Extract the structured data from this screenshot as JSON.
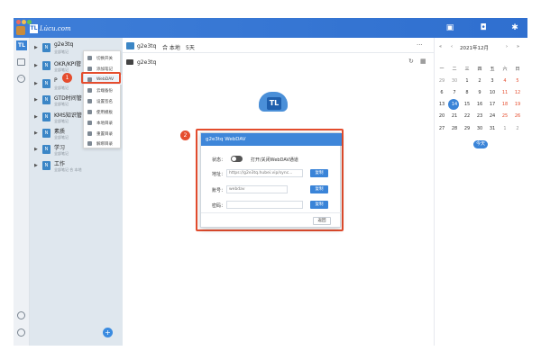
{
  "app": {
    "logo_text": "TL",
    "wordmark": "Lu̇cu.com"
  },
  "topbar_icons": [
    "note-icon",
    "shield-icon",
    "bug-icon"
  ],
  "sidebar_icons": [
    "pi-logo-icon",
    "inbox-icon",
    "dots-icon"
  ],
  "tree": [
    {
      "title": "g2e3tq",
      "sub": "全部笔记"
    },
    {
      "title": "OKR/KPI管",
      "sub": "全部笔记"
    },
    {
      "title": "P",
      "sub": "全部笔记"
    },
    {
      "title": "GTD时间管",
      "sub": "全部笔记"
    },
    {
      "title": "KMS知识管",
      "sub": "全部笔记"
    },
    {
      "title": "素质",
      "sub": "全部笔记"
    },
    {
      "title": "学习",
      "sub": "全部笔记"
    },
    {
      "title": "工作",
      "sub": "全部笔记 合 本地"
    }
  ],
  "context_menu": [
    "切换开关",
    "添加笔记",
    "WebDAV",
    "云端备份",
    "设置签名",
    "使用模板",
    "本地目录",
    "重置目录",
    "解绑目录"
  ],
  "badges": {
    "one": "1",
    "two": "2"
  },
  "toolbar": {
    "notebook": "g2e3tq",
    "location": "合 本地",
    "days": "5天",
    "more": "···"
  },
  "breadcrumb": {
    "folder": "g2e3tq"
  },
  "dialog": {
    "title": "g2e3tq WebDAV",
    "status_label": "状态：",
    "toggle_text": "打开/关闭WebDAV通道",
    "addr_label": "地址：",
    "addr_value": "https://g2e3tq.hubei.vip/sync...",
    "account_label": "账号：",
    "account_value": "webdav",
    "password_label": "密码：",
    "copy_label": "复制",
    "back_label": "返回"
  },
  "calendar": {
    "month": "2021年12月",
    "weekdays": [
      "一",
      "二",
      "三",
      "四",
      "五",
      "六",
      "日"
    ],
    "weeks": [
      [
        "29",
        "30",
        "1",
        "2",
        "3",
        "4",
        "5"
      ],
      [
        "6",
        "7",
        "8",
        "9",
        "10",
        "11",
        "12"
      ],
      [
        "13",
        "14",
        "15",
        "16",
        "17",
        "18",
        "19"
      ],
      [
        "20",
        "21",
        "22",
        "23",
        "24",
        "25",
        "26"
      ],
      [
        "27",
        "28",
        "29",
        "30",
        "31",
        "1",
        "2"
      ]
    ],
    "today_label": "今天",
    "selected_day": "14"
  },
  "add_button": "+"
}
